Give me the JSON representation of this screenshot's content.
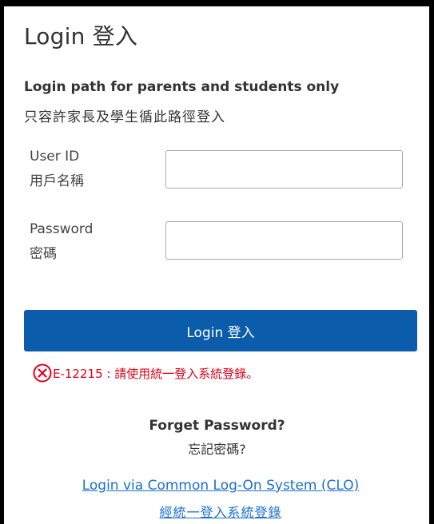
{
  "header": {
    "title": "Login 登入"
  },
  "notice": {
    "line_en": "Login path for parents and students only",
    "line_zh": "只容許家長及學生循此路徑登入"
  },
  "fields": {
    "user_id": {
      "label_en": "User ID",
      "label_zh": "用戶名稱",
      "value": ""
    },
    "password": {
      "label_en": "Password",
      "label_zh": "密碼",
      "value": ""
    }
  },
  "login_button": {
    "label": "Login 登入",
    "color": "#0b5cab"
  },
  "error": {
    "icon": "circle-x-icon",
    "message": "E-12215 : 請使用統一登入系統登錄。",
    "color": "#e0001a"
  },
  "forget_password": {
    "label_en": "Forget Password?",
    "label_zh": "忘記密碼?"
  },
  "clo_link": {
    "label_en": "Login via Common Log-On System (CLO)",
    "label_zh": "經統一登入系統登錄",
    "color": "#1a6fd0"
  }
}
